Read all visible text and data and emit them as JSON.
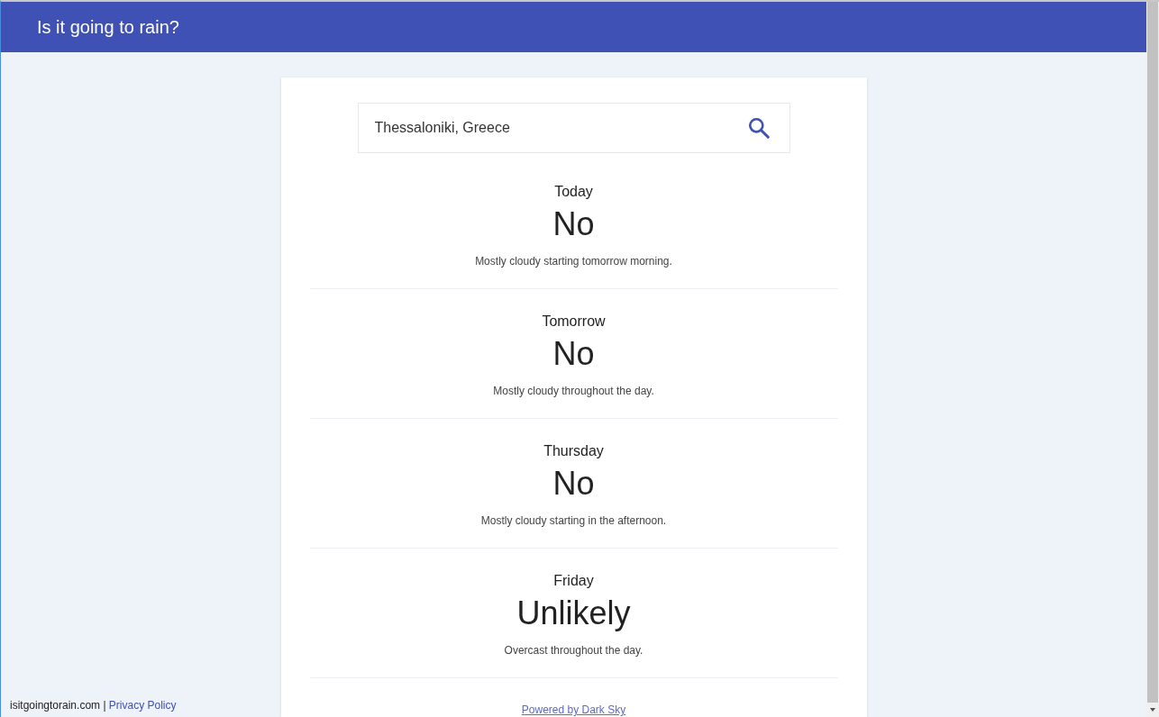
{
  "header": {
    "title": "Is it going to rain?"
  },
  "search": {
    "value": "Thessaloniki, Greece"
  },
  "forecasts": [
    {
      "day": "Today",
      "answer": "No",
      "summary": "Mostly cloudy starting tomorrow morning."
    },
    {
      "day": "Tomorrow",
      "answer": "No",
      "summary": "Mostly cloudy throughout the day."
    },
    {
      "day": "Thursday",
      "answer": "No",
      "summary": "Mostly cloudy starting in the afternoon."
    },
    {
      "day": "Friday",
      "answer": "Unlikely",
      "summary": "Overcast throughout the day."
    }
  ],
  "credit": "Powered by Dark Sky",
  "footer": {
    "site": "isitgoingtorain.com",
    "separator": "|",
    "link": "Privacy Policy"
  }
}
